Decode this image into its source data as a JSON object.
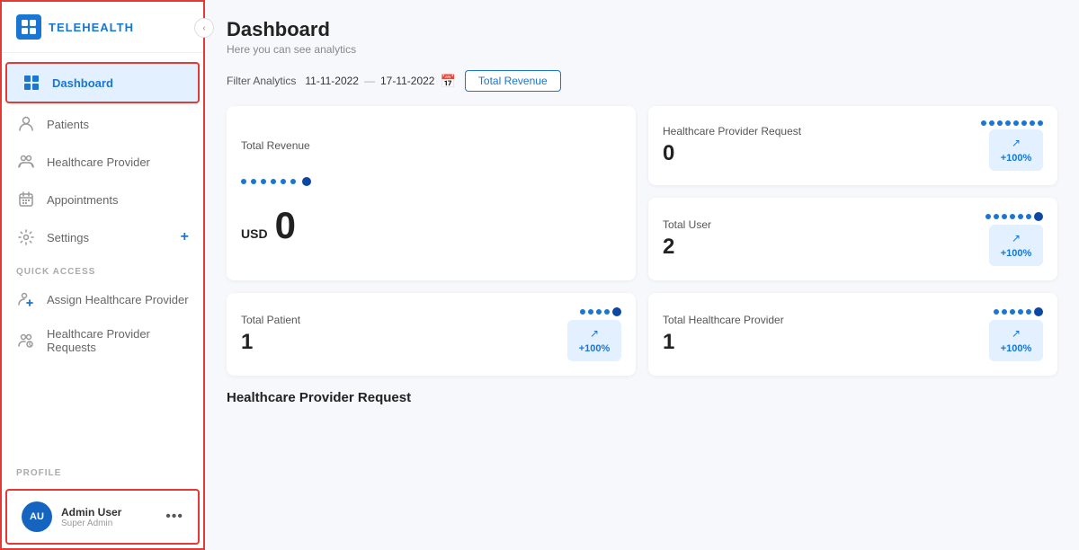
{
  "sidebar": {
    "logo_text": "TELEHEALTH",
    "nav_items": [
      {
        "id": "dashboard",
        "label": "Dashboard",
        "icon": "⊞",
        "active": true
      },
      {
        "id": "patients",
        "label": "Patients",
        "icon": "👤",
        "active": false
      },
      {
        "id": "healthcare-provider",
        "label": "Healthcare Provider",
        "icon": "👥",
        "active": false
      },
      {
        "id": "appointments",
        "label": "Appointments",
        "icon": "📅",
        "active": false
      },
      {
        "id": "settings",
        "label": "Settings",
        "icon": "⚙",
        "active": false,
        "has_plus": true
      }
    ],
    "quick_access_label": "QUICK ACCESS",
    "quick_access_items": [
      {
        "id": "assign-hp",
        "label": "Assign Healthcare Provider",
        "icon": "👥"
      },
      {
        "id": "hp-requests",
        "label": "Healthcare Provider Requests",
        "icon": "👥"
      }
    ],
    "profile_section_label": "PROFILE",
    "profile": {
      "initials": "AU",
      "name": "Admin User",
      "role": "Super Admin",
      "dots": "•••"
    }
  },
  "main": {
    "title": "Dashboard",
    "subtitle": "Here you can see analytics",
    "filter": {
      "label": "Filter Analytics",
      "date_from": "11-11-2022",
      "date_separator": "—",
      "date_to": "17-11-2022",
      "btn_label": "Total Revenue"
    },
    "total_revenue": {
      "label": "Total Revenue",
      "prefix": "USD",
      "value": "0"
    },
    "stats": [
      {
        "id": "hp-request",
        "label": "Healthcare Provider Request",
        "value": "0",
        "trend": "+100%",
        "dots": 8
      },
      {
        "id": "total-user",
        "label": "Total User",
        "value": "2",
        "trend": "+100%",
        "dots": 7
      }
    ],
    "bottom_stats": [
      {
        "id": "total-patient",
        "label": "Total Patient",
        "value": "1",
        "trend": "+100%",
        "dots": 5
      },
      {
        "id": "total-hp",
        "label": "Total Healthcare Provider",
        "value": "1",
        "trend": "+100%",
        "dots": 6
      }
    ],
    "section_bottom_title": "Healthcare Provider Request"
  },
  "colors": {
    "primary": "#1976d2",
    "accent": "#e3f0ff",
    "danger": "#e53935"
  }
}
